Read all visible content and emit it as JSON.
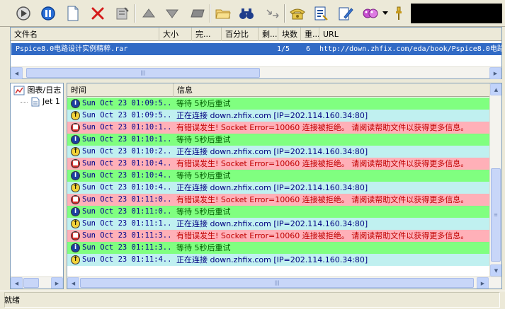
{
  "toolbar": {
    "buttons": [
      {
        "name": "start",
        "icon": "play-icon"
      },
      {
        "name": "pause",
        "icon": "pause-icon"
      },
      {
        "name": "new",
        "icon": "new-file-icon"
      },
      {
        "name": "delete",
        "icon": "delete-icon"
      },
      {
        "name": "properties",
        "icon": "properties-icon"
      },
      {
        "name": "move-up",
        "icon": "arrow-up-icon"
      },
      {
        "name": "move-down",
        "icon": "arrow-down-icon"
      },
      {
        "name": "rename",
        "icon": "rename-icon"
      },
      {
        "name": "open-folder",
        "icon": "folder-icon"
      },
      {
        "name": "find",
        "icon": "binoculars-icon"
      },
      {
        "name": "connect",
        "icon": "connect-icon"
      },
      {
        "name": "dial",
        "icon": "phone-icon"
      },
      {
        "name": "options",
        "icon": "options-icon"
      },
      {
        "name": "edit",
        "icon": "edit-icon"
      },
      {
        "name": "skin",
        "icon": "skin-icon"
      },
      {
        "name": "more",
        "icon": "pin-icon"
      }
    ]
  },
  "download_list": {
    "columns": [
      "文件名",
      "大小",
      "完...",
      "百分比",
      "剩...",
      "块数",
      "重...",
      "URL"
    ],
    "rows": [
      {
        "filename": "Pspice8.0电路设计实例精粹.rar",
        "blocks": "1/5",
        "retries": "6",
        "url": "http://down.zhfix.com/eda/book/Pspice8.0电路"
      }
    ]
  },
  "tree": {
    "items": [
      {
        "label": "图表/日志",
        "icon": "chart-icon"
      },
      {
        "label": "Jet 1",
        "icon": "document-icon"
      }
    ]
  },
  "log": {
    "columns": [
      "时间",
      "信息"
    ],
    "colors": {
      "green": "#80ff80",
      "cyan": "#c0f0f0",
      "pink": "#ffb0b8",
      "error_text": "#c00000",
      "normal_text": "#000080",
      "green_text": "#006000"
    },
    "rows": [
      {
        "type": "info",
        "time": "Sun Oct 23 01:09:5...",
        "msg": "等待 5秒后重试",
        "bg": "green"
      },
      {
        "type": "connect",
        "time": "Sun Oct 23 01:09:5...",
        "msg": "正在连接 down.zhfix.com [IP=202.114.160.34:80]",
        "bg": "cyan"
      },
      {
        "type": "error",
        "time": "Sun Oct 23 01:10:1...",
        "msg": "有错误发生! Socket Error=10060 连接被拒绝。 请阅读帮助文件以获得更多信息。",
        "bg": "pink"
      },
      {
        "type": "info",
        "time": "Sun Oct 23 01:10:1...",
        "msg": "等待 5秒后重试",
        "bg": "green"
      },
      {
        "type": "connect",
        "time": "Sun Oct 23 01:10:2...",
        "msg": "正在连接 down.zhfix.com [IP=202.114.160.34:80]",
        "bg": "cyan"
      },
      {
        "type": "error",
        "time": "Sun Oct 23 01:10:4...",
        "msg": "有错误发生! Socket Error=10060 连接被拒绝。 请阅读帮助文件以获得更多信息。",
        "bg": "pink"
      },
      {
        "type": "info",
        "time": "Sun Oct 23 01:10:4...",
        "msg": "等待 5秒后重试",
        "bg": "green"
      },
      {
        "type": "connect",
        "time": "Sun Oct 23 01:10:4...",
        "msg": "正在连接 down.zhfix.com [IP=202.114.160.34:80]",
        "bg": "cyan"
      },
      {
        "type": "error",
        "time": "Sun Oct 23 01:11:0...",
        "msg": "有错误发生! Socket Error=10060 连接被拒绝。 请阅读帮助文件以获得更多信息。",
        "bg": "pink"
      },
      {
        "type": "info",
        "time": "Sun Oct 23 01:11:0...",
        "msg": "等待 5秒后重试",
        "bg": "green"
      },
      {
        "type": "connect",
        "time": "Sun Oct 23 01:11:1...",
        "msg": "正在连接 down.zhfix.com [IP=202.114.160.34:80]",
        "bg": "cyan"
      },
      {
        "type": "error",
        "time": "Sun Oct 23 01:11:3...",
        "msg": "有错误发生! Socket Error=10060 连接被拒绝。 请阅读帮助文件以获得更多信息。",
        "bg": "pink"
      },
      {
        "type": "info",
        "time": "Sun Oct 23 01:11:3...",
        "msg": "等待 5秒后重试",
        "bg": "green"
      },
      {
        "type": "connect",
        "time": "Sun Oct 23 01:11:4...",
        "msg": "正在连接 down.zhfix.com [IP=202.114.160.34:80]",
        "bg": "cyan"
      }
    ]
  },
  "status": {
    "text": "就绪"
  }
}
